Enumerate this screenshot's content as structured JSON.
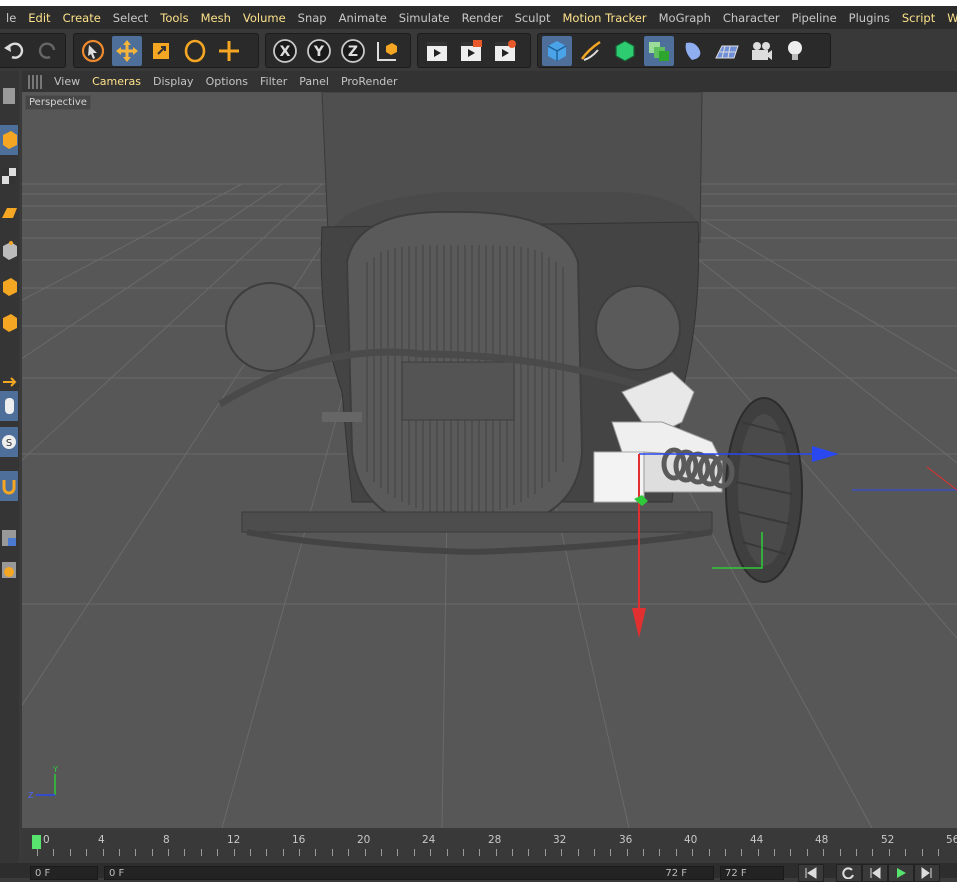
{
  "menubar": {
    "items": [
      {
        "label": "le",
        "highlight": false
      },
      {
        "label": "Edit",
        "highlight": true
      },
      {
        "label": "Create",
        "highlight": true
      },
      {
        "label": "Select",
        "highlight": false
      },
      {
        "label": "Tools",
        "highlight": true
      },
      {
        "label": "Mesh",
        "highlight": true
      },
      {
        "label": "Volume",
        "highlight": true
      },
      {
        "label": "Snap",
        "highlight": false
      },
      {
        "label": "Animate",
        "highlight": false
      },
      {
        "label": "Simulate",
        "highlight": false
      },
      {
        "label": "Render",
        "highlight": false
      },
      {
        "label": "Sculpt",
        "highlight": false
      },
      {
        "label": "Motion Tracker",
        "highlight": true
      },
      {
        "label": "MoGraph",
        "highlight": false
      },
      {
        "label": "Character",
        "highlight": false
      },
      {
        "label": "Pipeline",
        "highlight": false
      },
      {
        "label": "Plugins",
        "highlight": false
      },
      {
        "label": "Script",
        "highlight": true
      },
      {
        "label": "Window",
        "highlight": true
      }
    ]
  },
  "toolbar": {
    "icons": [
      "undo-icon",
      "redo-icon",
      "live-selection-icon",
      "move-icon",
      "scale-icon",
      "rotate-icon",
      "add-object-icon",
      "x-axis-lock-icon",
      "y-axis-lock-icon",
      "z-axis-lock-icon",
      "coordinate-system-icon",
      "render-view-icon",
      "render-to-picture-viewer-icon",
      "render-settings-icon",
      "cube-primitive-icon",
      "pen-spline-icon",
      "subdivision-surface-icon",
      "array-icon",
      "deformer-icon",
      "floor-icon",
      "camera-icon",
      "light-icon"
    ]
  },
  "viewport_menu": {
    "items": [
      {
        "label": "View",
        "highlight": false
      },
      {
        "label": "Cameras",
        "highlight": true
      },
      {
        "label": "Display",
        "highlight": false
      },
      {
        "label": "Options",
        "highlight": false
      },
      {
        "label": "Filter",
        "highlight": false
      },
      {
        "label": "Panel",
        "highlight": false
      },
      {
        "label": "ProRender",
        "highlight": false
      }
    ]
  },
  "viewport": {
    "label": "Perspective",
    "axis_y_label": "Y",
    "axis_z_label": "Z"
  },
  "timeline": {
    "ticks": [
      "0",
      "4",
      "8",
      "12",
      "16",
      "20",
      "24",
      "28",
      "32",
      "36",
      "40",
      "44",
      "48",
      "52",
      "56"
    ],
    "current_frame": "0"
  },
  "bottom": {
    "current_frame_field": "0 F",
    "min_field": "0 F",
    "max_field": "72 F",
    "end_field": "72 F"
  },
  "colors": {
    "menu_highlight": "#fde28a",
    "axis_x": "#e23030",
    "axis_y": "#2ecc3a",
    "axis_z": "#2a48f0",
    "active_tool": "#4d6f9a",
    "playhead": "#58e26e"
  }
}
